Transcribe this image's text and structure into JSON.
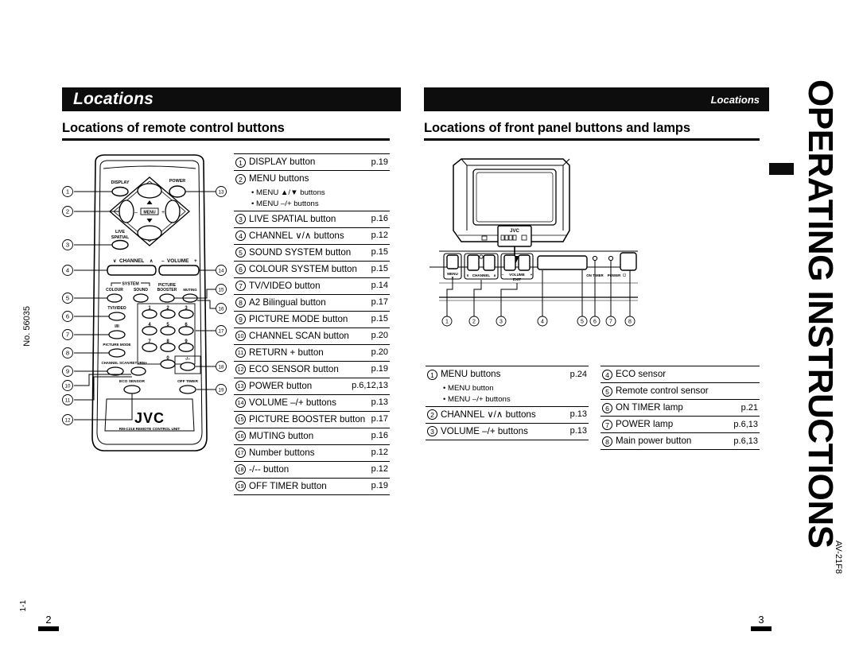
{
  "document": {
    "side_title": "OPERATING INSTRUCTIONS",
    "model": "AV-21F8",
    "doc_no": "No. 56035",
    "section_code": "1-1",
    "left_page_number": "2",
    "right_page_number": "3"
  },
  "left_panel": {
    "banner": "Locations",
    "heading": "Locations of remote control buttons",
    "remote": {
      "brand": "JVC",
      "model_line": "RM-C218 REMOTE CONTROL UNIT",
      "labels": {
        "display": "DISPLAY",
        "power": "POWER",
        "menu": "MENU",
        "live": "LIVE",
        "spatial": "SPATIAL",
        "channel": "CHANNEL",
        "volume": "VOLUME",
        "system": "SYSTEM",
        "colour": "COLOUR",
        "sound": "SOUND",
        "picture": "PICTURE",
        "booster": "BOOSTER",
        "muting": "MUTING",
        "tv_video": "TV/VIDEO",
        "bilingual": "I/II",
        "picture_mode": "PICTURE MODE",
        "channel_scan": "CHANNEL SCAN",
        "return_plus": "RETURN+",
        "eco_sensor": "ECO SENSOR",
        "off_timer": "OFF TIMER",
        "minus_dash": "-/--",
        "minus": "−",
        "plus": "+",
        "up": "▲",
        "down": "▼",
        "ch_down": "∨",
        "ch_up": "∧"
      },
      "keypad": [
        "1",
        "2",
        "3",
        "4",
        "5",
        "6",
        "7",
        "8",
        "9",
        "0"
      ],
      "callouts": [
        "1",
        "2",
        "3",
        "4",
        "5",
        "6",
        "7",
        "8",
        "9",
        "10",
        "11",
        "12",
        "13",
        "14",
        "15",
        "16",
        "17",
        "18",
        "19"
      ]
    },
    "items": [
      {
        "num": "1",
        "label": "DISPLAY button",
        "page": "p.19",
        "subs": []
      },
      {
        "num": "2",
        "label": "MENU buttons",
        "page": "",
        "subs": [
          "• MENU ▲/▼ buttons",
          "• MENU –/+ buttons"
        ]
      },
      {
        "num": "3",
        "label": "LIVE SPATIAL button",
        "page": "p.16",
        "subs": []
      },
      {
        "num": "4",
        "label": "CHANNEL ∨/∧ buttons",
        "page": "p.12",
        "subs": []
      },
      {
        "num": "5",
        "label": "SOUND SYSTEM button",
        "page": "p.15",
        "subs": []
      },
      {
        "num": "6",
        "label": "COLOUR SYSTEM button",
        "page": "p.15",
        "subs": []
      },
      {
        "num": "7",
        "label": "TV/VIDEO button",
        "page": "p.14",
        "subs": []
      },
      {
        "num": "8",
        "label": "A2 Bilingual button",
        "page": "p.17",
        "subs": []
      },
      {
        "num": "9",
        "label": "PICTURE MODE button",
        "page": "p.15",
        "subs": []
      },
      {
        "num": "10",
        "label": "CHANNEL SCAN button",
        "page": "p.20",
        "subs": []
      },
      {
        "num": "11",
        "label": "RETURN + button",
        "page": "p.20",
        "subs": []
      },
      {
        "num": "12",
        "label": "ECO SENSOR button",
        "page": "p.19",
        "subs": []
      },
      {
        "num": "13",
        "label": "POWER button",
        "page": "p.6,12,13",
        "subs": []
      },
      {
        "num": "14",
        "label": "VOLUME –/+ buttons",
        "page": "p.13",
        "subs": []
      },
      {
        "num": "15",
        "label": "PICTURE BOOSTER button",
        "page": "p.17",
        "subs": []
      },
      {
        "num": "16",
        "label": "MUTING button",
        "page": "p.16",
        "subs": []
      },
      {
        "num": "17",
        "label": "Number buttons",
        "page": "p.12",
        "subs": []
      },
      {
        "num": "18",
        "label": "-/-- button",
        "page": "p.12",
        "subs": []
      },
      {
        "num": "19",
        "label": "OFF TIMER button",
        "page": "p.19",
        "subs": []
      }
    ]
  },
  "right_panel": {
    "banner": "Locations",
    "heading": "Locations of front panel buttons and lamps",
    "tv": {
      "brand": "JVC",
      "panel_labels": {
        "menu": "MENU",
        "menu_down": "▼",
        "channel": "CHANNEL",
        "ch_down": "∨",
        "ch_up": "∧",
        "volume": "VOLUME",
        "exit": "EXIT",
        "minus": "−",
        "plus": "+",
        "on_timer": "ON TIMER",
        "power": "POWER",
        "standby": "⏻"
      },
      "callouts": [
        "1",
        "2",
        "3",
        "4",
        "5",
        "6",
        "7",
        "8"
      ]
    },
    "items_left": [
      {
        "num": "1",
        "label": "MENU buttons",
        "page": "p.24",
        "subs": [
          "• MENU button",
          "• MENU –/+ buttons"
        ]
      },
      {
        "num": "2",
        "label": "CHANNEL ∨/∧ buttons",
        "page": "p.13",
        "subs": []
      },
      {
        "num": "3",
        "label": "VOLUME –/+ buttons",
        "page": "p.13",
        "subs": []
      }
    ],
    "items_right": [
      {
        "num": "4",
        "label": "ECO sensor",
        "page": "",
        "subs": []
      },
      {
        "num": "5",
        "label": "Remote control sensor",
        "page": "",
        "subs": []
      },
      {
        "num": "6",
        "label": "ON TIMER lamp",
        "page": "p.21",
        "subs": []
      },
      {
        "num": "7",
        "label": "POWER lamp",
        "page": "p.6,13",
        "subs": []
      },
      {
        "num": "8",
        "label": "Main power button",
        "page": "p.6,13",
        "subs": []
      }
    ]
  },
  "colors": {
    "banner_bg": "#0d0d0d",
    "banner_fg": "#ffffff",
    "rule": "#000000",
    "page_bg": "#ffffff"
  }
}
